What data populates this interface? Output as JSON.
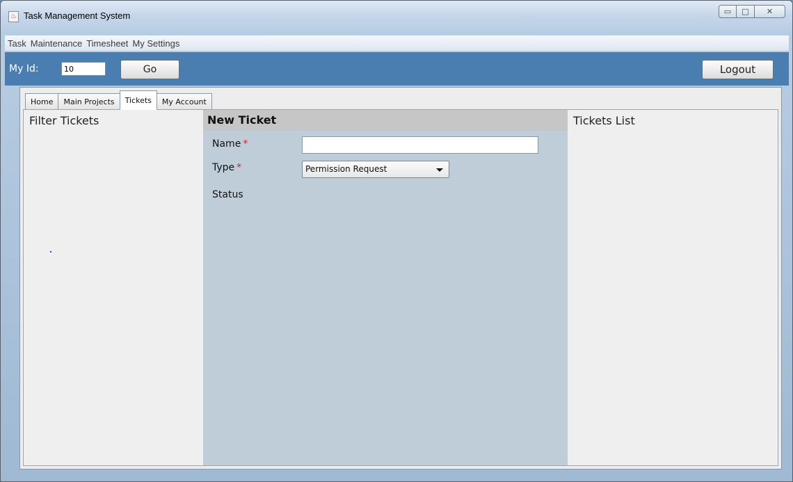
{
  "window": {
    "title": "Task Management System",
    "controls": {
      "minimize": "▭",
      "maximize": "□",
      "close": "✕"
    }
  },
  "menu": {
    "items": [
      "Task",
      "Maintenance",
      "Timesheet",
      "My Settings"
    ]
  },
  "toolbar": {
    "myid_label": "My Id:",
    "myid_value": "10",
    "go_label": "Go",
    "logout_label": "Logout"
  },
  "tabs": [
    {
      "label": "Home",
      "active": false
    },
    {
      "label": "Main Projects",
      "active": false
    },
    {
      "label": "Tickets",
      "active": true
    },
    {
      "label": "My Account",
      "active": false
    }
  ],
  "tickets_page": {
    "filter_title": "Filter Tickets",
    "new_ticket": {
      "title": "New Ticket",
      "name_label": "Name",
      "name_value": "",
      "type_label": "Type",
      "type_value": "Permission Request",
      "status_label": "Status",
      "required_marker": "*"
    },
    "list_title": "Tickets List"
  },
  "colors": {
    "toolbar_bg": "#4a7eb0",
    "new_ticket_bg": "#bfcdd9",
    "required": "#d42020"
  }
}
